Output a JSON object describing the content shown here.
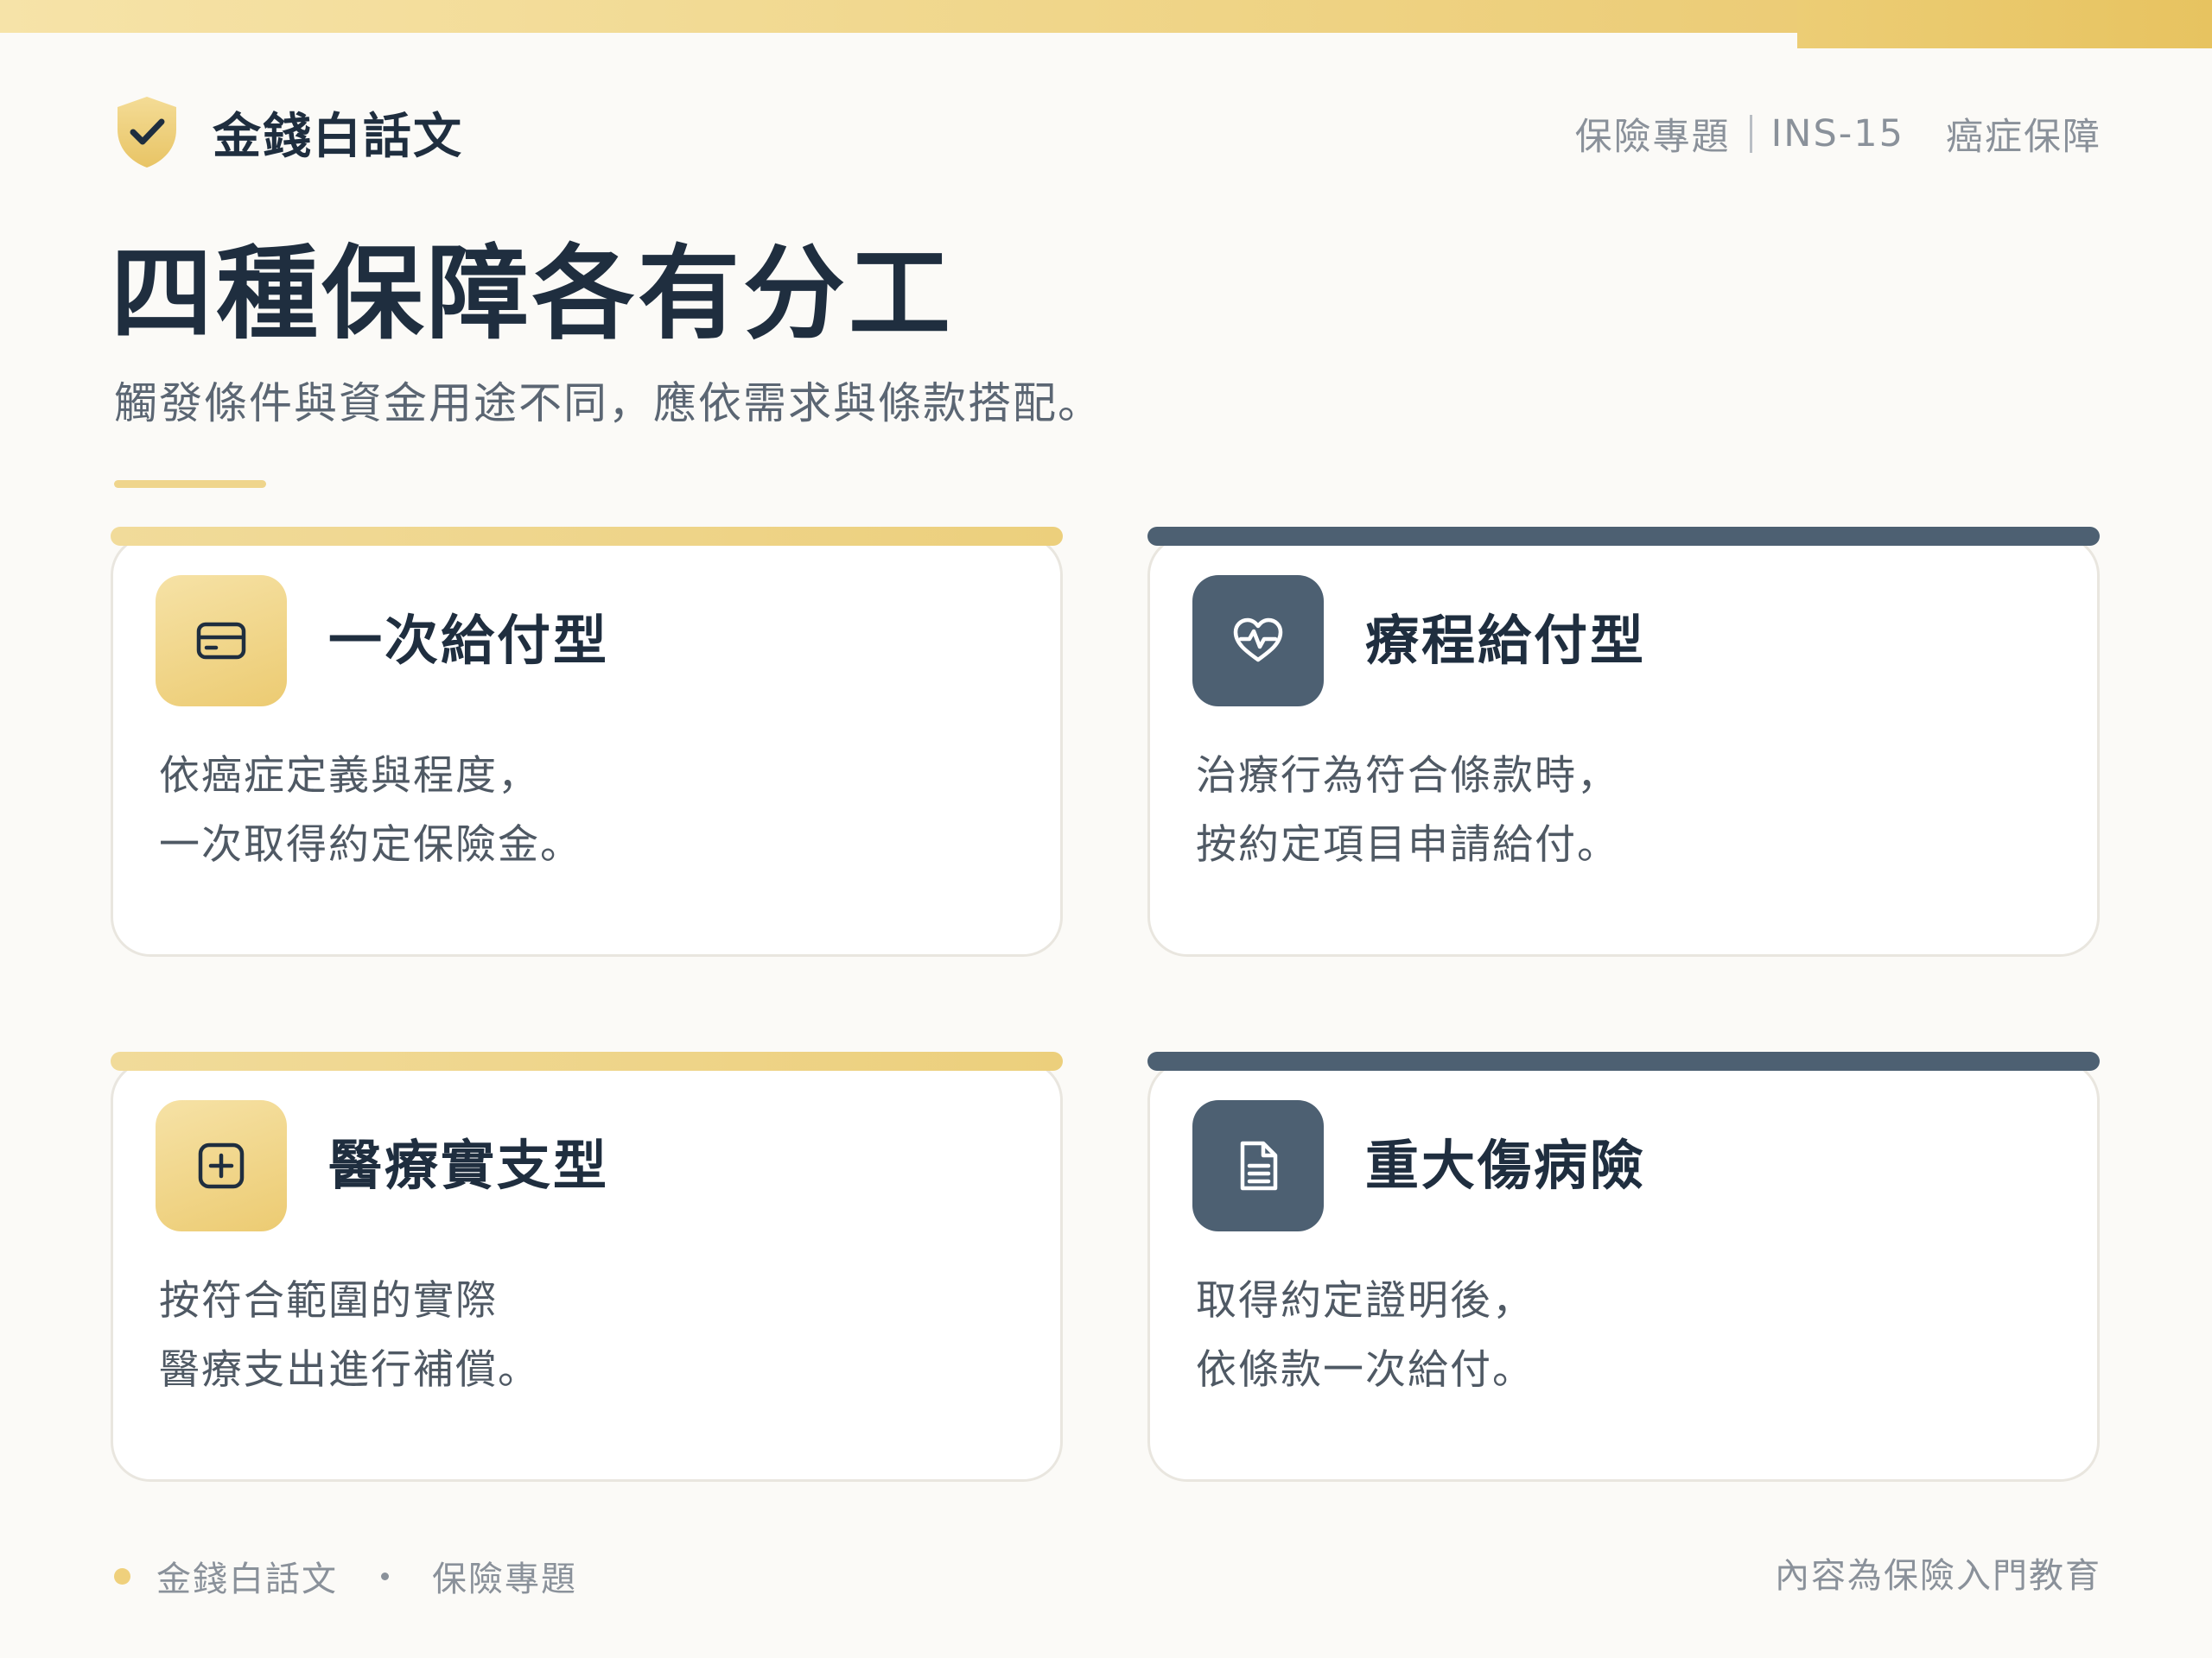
{
  "brand": {
    "name": "金錢白話文",
    "icon": "shield-check-icon"
  },
  "header": {
    "category": "保險專題",
    "code": "INS-15",
    "topic": "癌症保障"
  },
  "title": "四種保障各有分工",
  "subtitle": "觸發條件與資金用途不同，應依需求與條款搭配。",
  "cards": [
    {
      "title": "一次給付型",
      "icon": "card-icon",
      "line1": "依癌症定義與程度，",
      "line2": "一次取得約定保險金。",
      "theme": "gold"
    },
    {
      "title": "療程給付型",
      "icon": "heart-pulse-icon",
      "line1": "治療行為符合條款時，",
      "line2": "按約定項目申請給付。",
      "theme": "slate"
    },
    {
      "title": "醫療實支型",
      "icon": "plus-square-icon",
      "line1": "按符合範圍的實際",
      "line2": "醫療支出進行補償。",
      "theme": "gold"
    },
    {
      "title": "重大傷病險",
      "icon": "document-icon",
      "line1": "取得約定證明後，",
      "line2": "依條款一次給付。",
      "theme": "slate"
    }
  ],
  "footer": {
    "brand": "金錢白話文",
    "category": "保險專題",
    "note": "內容為保險入門教育"
  },
  "colors": {
    "gold": "#ecce78",
    "slate": "#4d6072",
    "text": "#1f2e3f",
    "muted": "#8a919a",
    "background": "#fbfaf7"
  }
}
